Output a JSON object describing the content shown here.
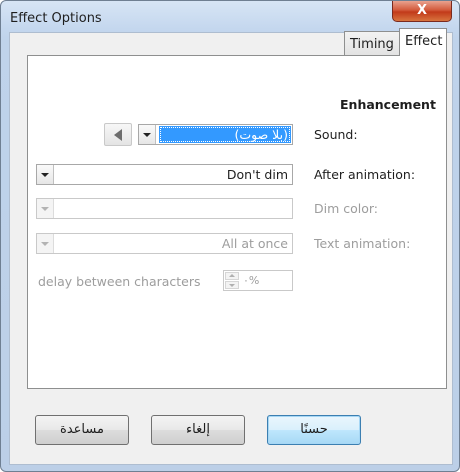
{
  "window": {
    "title": "Effect Options",
    "close_label": "X"
  },
  "tabs": [
    {
      "label": "Timing"
    },
    {
      "label": "Effect"
    }
  ],
  "enhancement": {
    "section_title": "Enhancement",
    "sound": {
      "label": "Sound:",
      "value": "(بلا صوت)"
    },
    "after_animation": {
      "label": "After animation:",
      "value": "Don't dim"
    },
    "dim_color": {
      "label": "Dim color:",
      "value": ""
    },
    "text_animation": {
      "label": "Text animation:",
      "value": "All at once"
    },
    "delay": {
      "label": "delay between characters",
      "value": "٠%"
    }
  },
  "buttons": {
    "ok": "حسنًا",
    "cancel": "إلغاء",
    "help": "مساعدة"
  }
}
